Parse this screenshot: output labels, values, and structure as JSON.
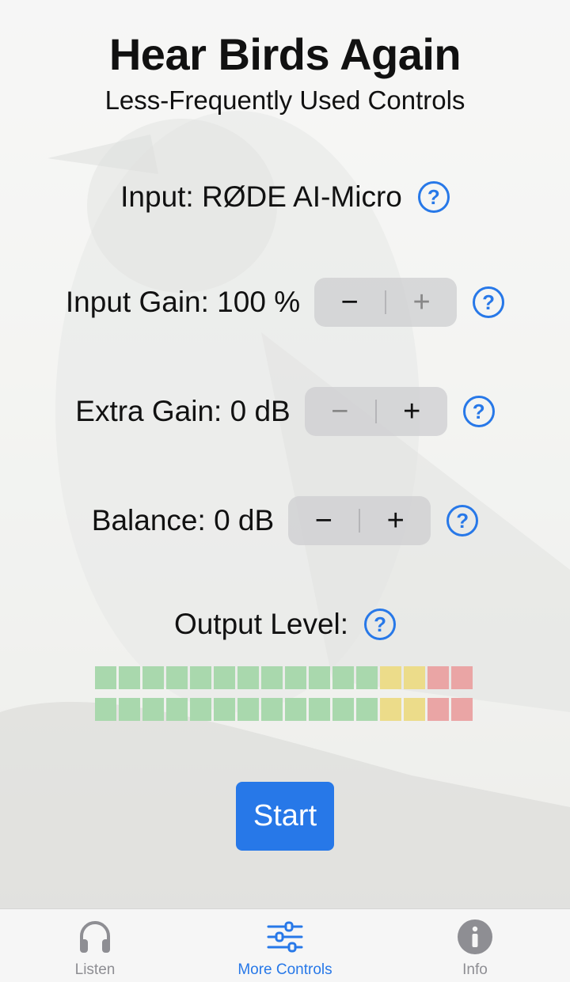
{
  "app": {
    "title": "Hear Birds Again",
    "subtitle": "Less-Frequently Used Controls"
  },
  "controls": {
    "input": {
      "label": "Input: RØDE AI-Micro",
      "help": "?"
    },
    "input_gain": {
      "label": "Input Gain: 100 %",
      "minus": "−",
      "plus": "+",
      "help": "?",
      "plus_enabled": false
    },
    "extra_gain": {
      "label": "Extra Gain: 0 dB",
      "minus": "−",
      "plus": "+",
      "help": "?",
      "minus_enabled": false
    },
    "balance": {
      "label": "Balance: 0 dB",
      "minus": "−",
      "plus": "+",
      "help": "?"
    },
    "output_level": {
      "label": "Output Level:",
      "help": "?"
    }
  },
  "meter": {
    "segments_per_row": 16,
    "rows": 2,
    "green_count": 12,
    "yellow_count": 2,
    "red_count": 2,
    "colors": {
      "green": "#a9d8ad",
      "yellow": "#ecdc8a",
      "red": "#eaa5a5"
    }
  },
  "start_button": {
    "label": "Start"
  },
  "tabbar": {
    "items": [
      {
        "label": "Listen",
        "icon": "headphones-icon",
        "active": false
      },
      {
        "label": "More Controls",
        "icon": "sliders-icon",
        "active": true
      },
      {
        "label": "Info",
        "icon": "info-icon",
        "active": false
      }
    ]
  },
  "colors": {
    "accent": "#2778e8",
    "inactive": "#8e8e93"
  }
}
